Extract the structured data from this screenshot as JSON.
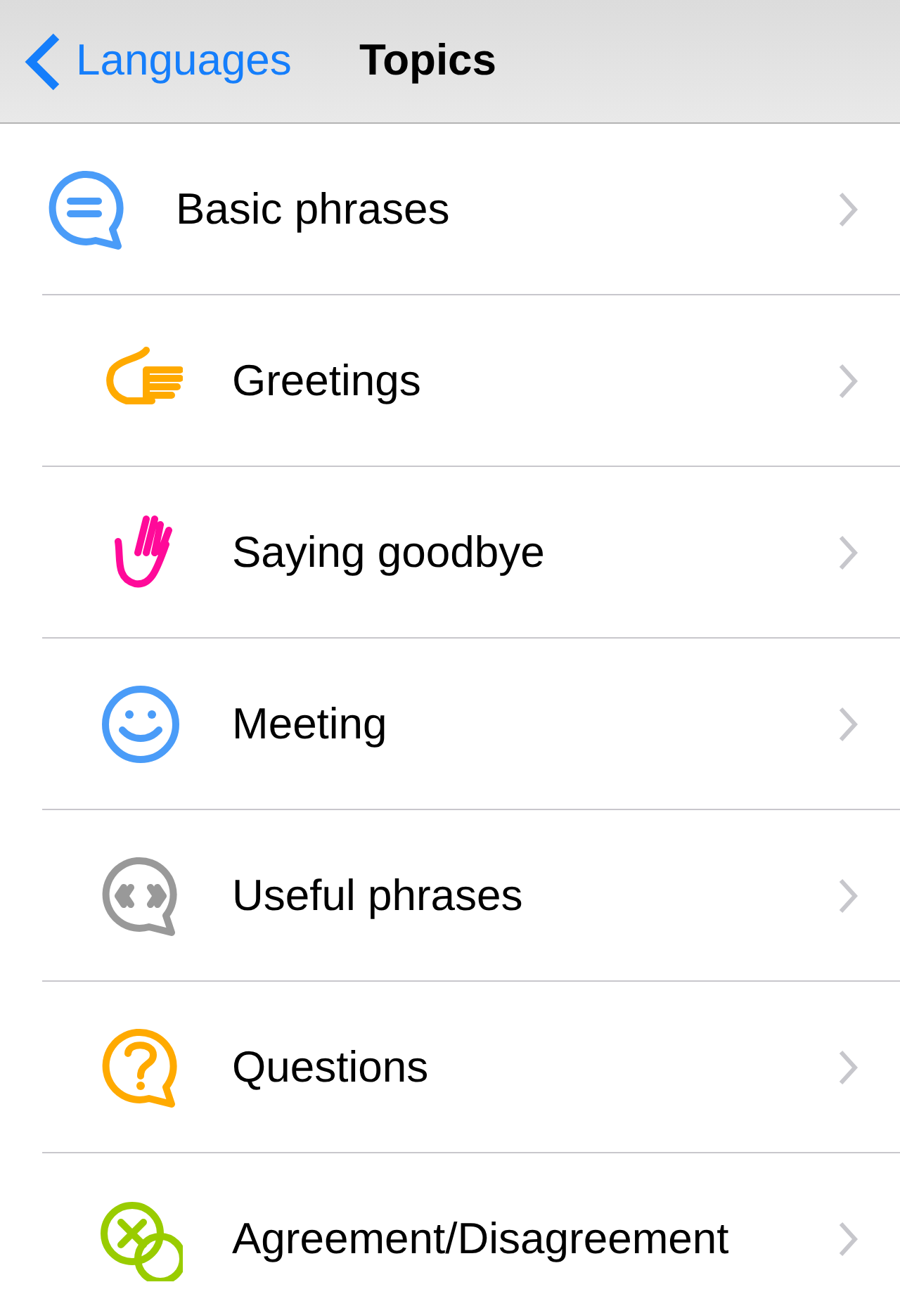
{
  "nav_bar": {
    "back_label": "Languages",
    "title": "Topics"
  },
  "topics": [
    {
      "label": "Basic phrases",
      "kind": "speech-bubble",
      "color": "#4a9cf8",
      "children": [
        {
          "label": "Greetings",
          "kind": "pointing-hand",
          "color": "#ffaa00"
        },
        {
          "label": "Saying goodbye",
          "kind": "waving-hand",
          "color": "#ff0a99"
        },
        {
          "label": "Meeting",
          "kind": "smiley",
          "color": "#4a9cf8"
        },
        {
          "label": "Useful phrases",
          "kind": "quote-bubble",
          "color": "#999999"
        },
        {
          "label": "Questions",
          "kind": "question-bubble",
          "color": "#ffaa00"
        },
        {
          "label": "Agreement/Disagreement",
          "kind": "cross-bubble",
          "color": "#99cc00"
        }
      ]
    }
  ]
}
